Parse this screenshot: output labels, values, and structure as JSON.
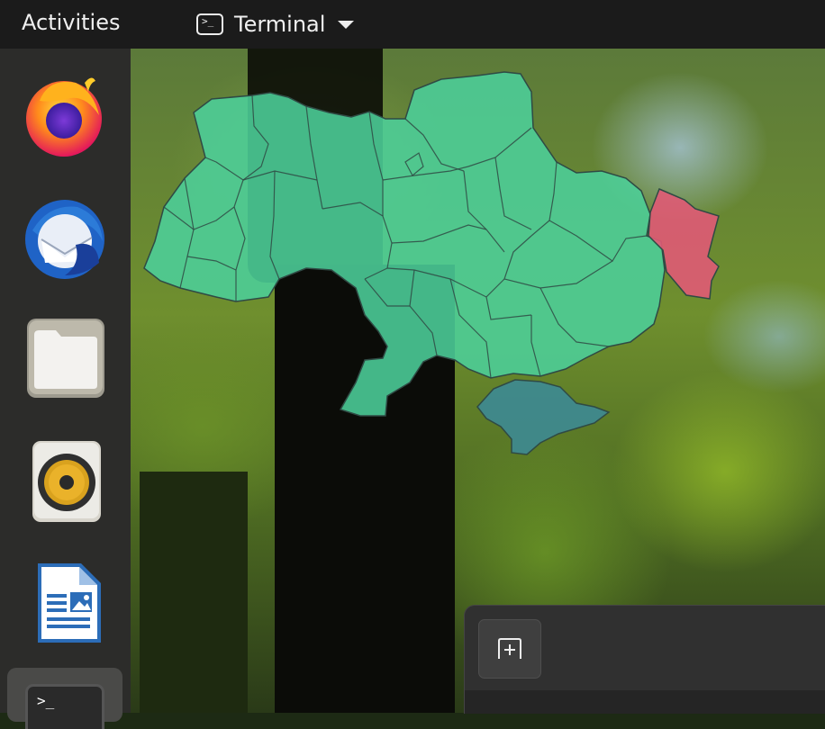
{
  "topbar": {
    "activities_label": "Activities",
    "app_menu_label": "Terminal",
    "app_menu_icon_text": ">_"
  },
  "dock": {
    "items": [
      {
        "name": "firefox",
        "icon": "firefox-icon"
      },
      {
        "name": "thunderbird",
        "icon": "thunderbird-icon"
      },
      {
        "name": "files",
        "icon": "files-icon"
      },
      {
        "name": "rhythmbox",
        "icon": "rhythmbox-icon"
      },
      {
        "name": "libreoffice-writer",
        "icon": "writer-icon"
      },
      {
        "name": "terminal",
        "icon": "terminal-icon",
        "active": true
      }
    ],
    "terminal_icon_text": ">_"
  },
  "map": {
    "region_color": "#4ccf9a",
    "highlight_color": "#e05a75",
    "crimea_color": "#3d8a94"
  },
  "terminal_window": {
    "new_tab_icon": "new-tab-icon"
  }
}
